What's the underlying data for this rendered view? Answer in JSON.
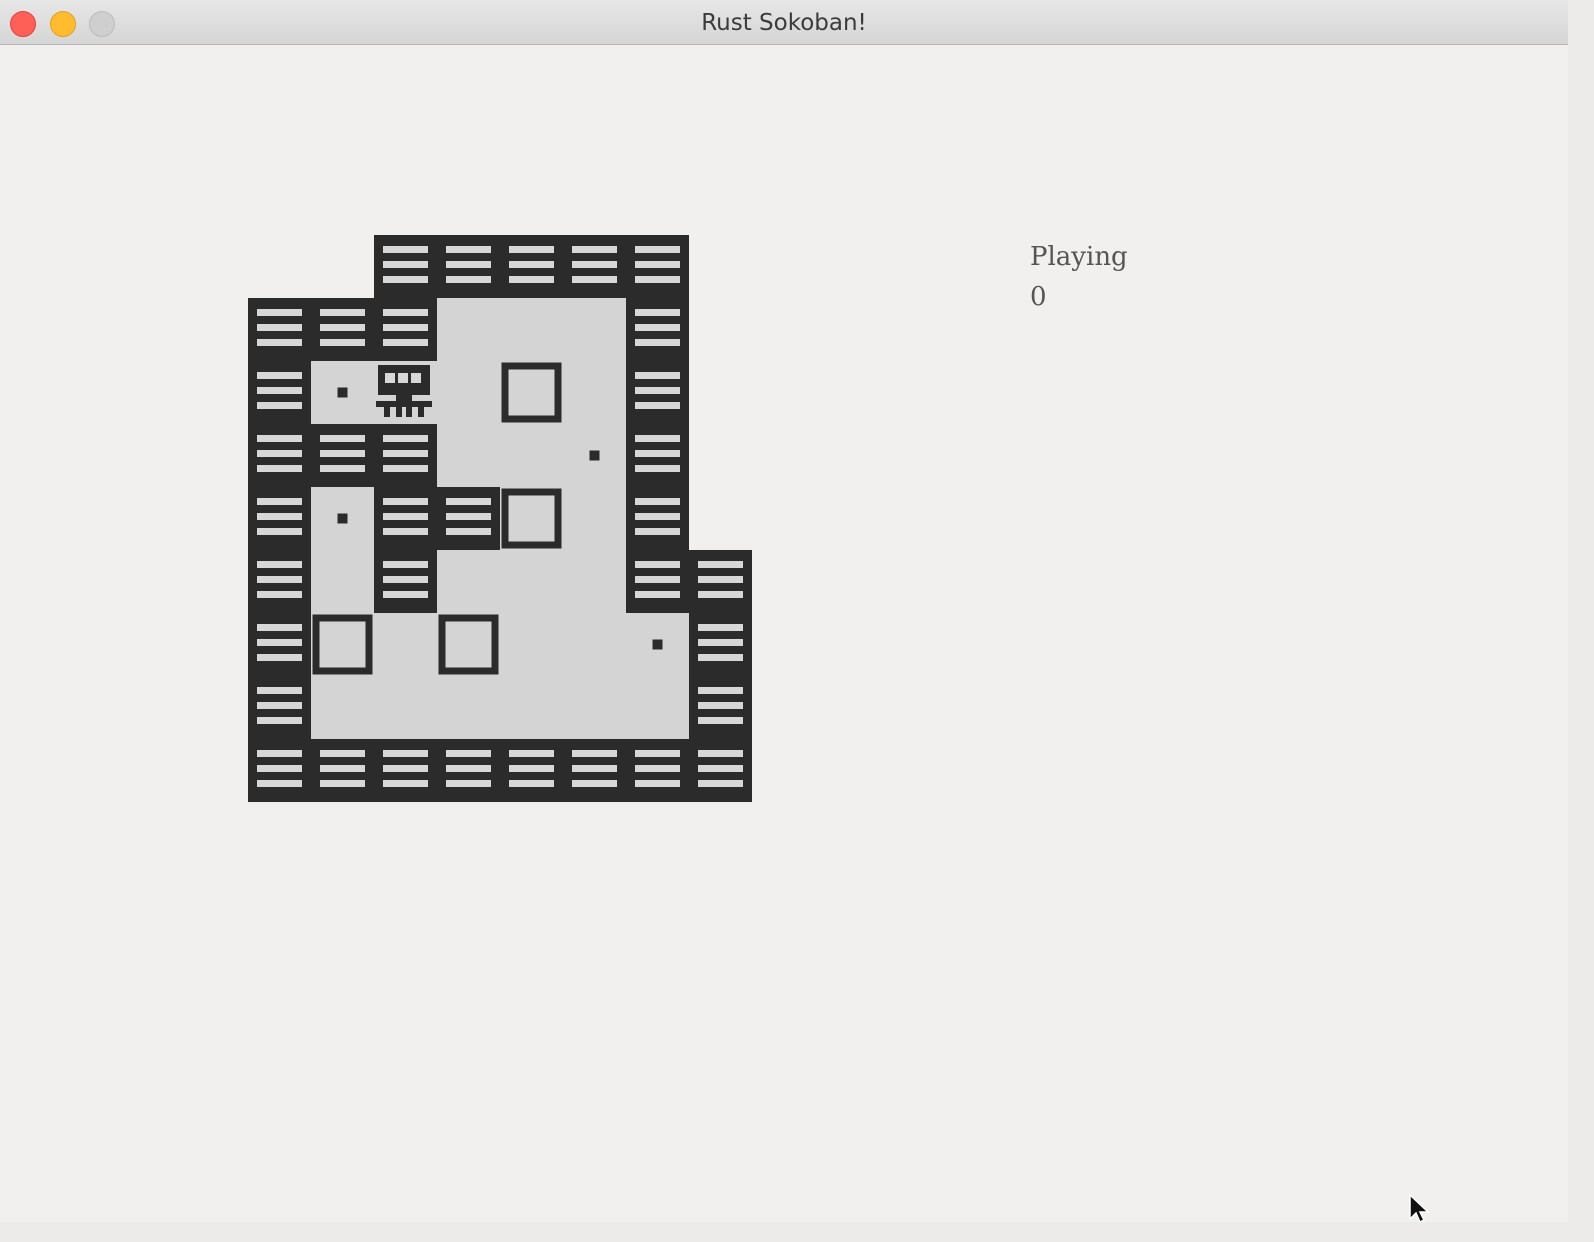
{
  "window": {
    "title": "Rust Sokoban!"
  },
  "hud": {
    "state": "Playing",
    "moves": "0"
  },
  "level": {
    "legend": {
      "W": "wall",
      "F": "floor",
      "P": "player",
      "B": "box",
      "S": "box-spot",
      "N": "empty"
    },
    "rows": [
      "NNWWWWWN",
      "WWWFFFWN",
      "WSPFBFWN",
      "WWWFFSWN",
      "WSWWBFWN",
      "WFWFFFWW",
      "WBFBFFSW",
      "WFFFFFFW",
      "WWWWWWWW"
    ]
  },
  "colors": {
    "wall": "#2b2b2b",
    "wall_stripe": "#d7d7d7",
    "floor": "#d4d4d4",
    "box_border": "#2b2b2b",
    "spot": "#2b2b2b",
    "background": "#f1f0ee"
  }
}
